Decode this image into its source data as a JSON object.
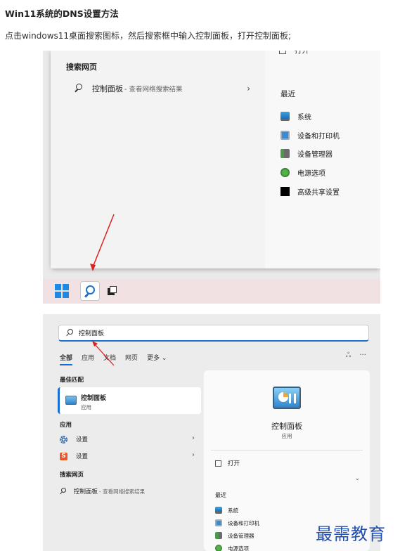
{
  "article": {
    "title": "Win11系统的DNS设置方法",
    "intro": "点击windows11桌面搜索图标，然后搜索框中输入控制面板，打开控制面板;"
  },
  "shot1": {
    "open_label": "打开",
    "web_heading": "搜索网页",
    "web_result": {
      "label": "控制面板",
      "sub": "- 查看网络搜索结果"
    },
    "recent_heading": "最近",
    "recent_items": [
      {
        "icon": "system-icon",
        "label": "系统"
      },
      {
        "icon": "printer-icon",
        "label": "设备和打印机"
      },
      {
        "icon": "device-manager-icon",
        "label": "设备管理器"
      },
      {
        "icon": "power-options-icon",
        "label": "电源选项"
      },
      {
        "icon": "sharing-icon",
        "label": "高级共享设置"
      }
    ],
    "taskbar_colors": {
      "bg": "#f2e1e3",
      "accent": "#1e88e5"
    }
  },
  "shot2": {
    "search_value": "控制面板",
    "tabs": [
      "全部",
      "应用",
      "文档",
      "网页",
      "更多 ⌄"
    ],
    "tab_right": [
      "ஃ",
      "···"
    ],
    "best_match_heading": "最佳匹配",
    "best_match": {
      "name": "控制面板",
      "type": "应用"
    },
    "apps_heading": "应用",
    "apps": [
      {
        "icon": "gear-icon",
        "label": "设置"
      },
      {
        "icon": "s-app-icon",
        "label": "设置",
        "glyph": "S"
      }
    ],
    "web_heading": "搜索网页",
    "web_result": {
      "label": "控制面板",
      "sub": "- 查看网络搜索结果"
    },
    "detail": {
      "name": "控制面板",
      "type": "应用",
      "open_label": "打开",
      "recent_heading": "最近",
      "recent_items": [
        "系统",
        "设备和打印机",
        "设备管理器",
        "电源选项"
      ]
    }
  },
  "watermark": "最需教育"
}
